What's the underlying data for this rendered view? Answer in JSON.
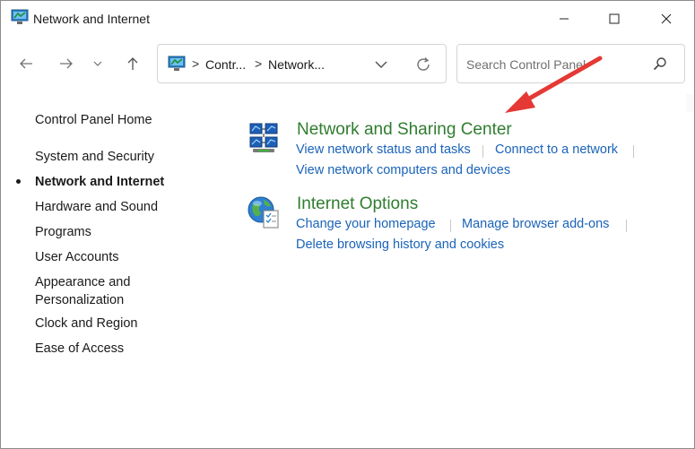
{
  "window": {
    "title": "Network and Internet"
  },
  "address": {
    "crumbs": [
      "Contr...",
      "Network..."
    ],
    "separator": ">"
  },
  "search": {
    "placeholder": "Search Control Panel"
  },
  "sidebar": {
    "items": [
      {
        "label": "Control Panel Home",
        "active": false
      },
      {
        "label": "System and Security",
        "active": false
      },
      {
        "label": "Network and Internet",
        "active": true
      },
      {
        "label": "Hardware and Sound",
        "active": false
      },
      {
        "label": "Programs",
        "active": false
      },
      {
        "label": "User Accounts",
        "active": false
      },
      {
        "label": "Appearance and",
        "active": false
      },
      {
        "label": "Personalization",
        "active": false
      },
      {
        "label": "Clock and Region",
        "active": false
      },
      {
        "label": "Ease of Access",
        "active": false
      }
    ]
  },
  "categories": [
    {
      "title": "Network and Sharing Center",
      "icon": "network-sharing-icon",
      "tasks": [
        "View network status and tasks",
        "Connect to a network",
        "View network computers and devices"
      ]
    },
    {
      "title": "Internet Options",
      "icon": "internet-options-icon",
      "tasks": [
        "Change your homepage",
        "Manage browser add-ons",
        "Delete browsing history and cookies"
      ]
    }
  ],
  "colors": {
    "category_title": "#2f7d2f",
    "task_link": "#1a63b8",
    "annotation_arrow": "#e53935"
  }
}
